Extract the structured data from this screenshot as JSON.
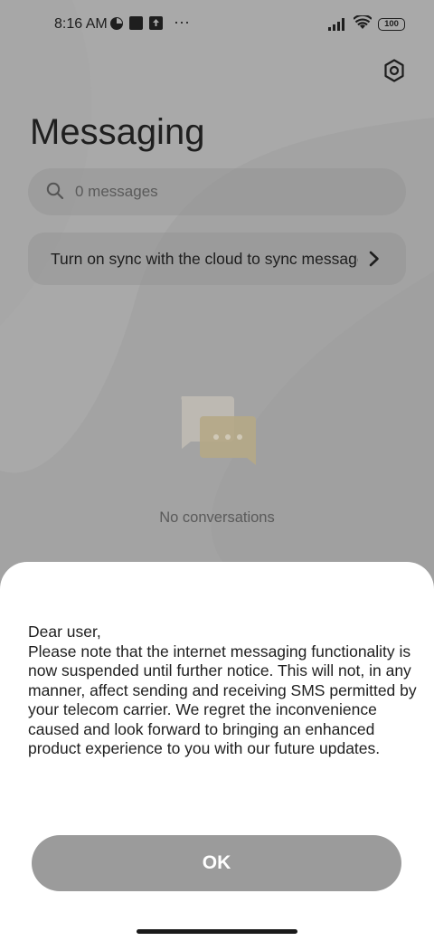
{
  "status_bar": {
    "time": "8:16 AM",
    "battery": "100",
    "icons": [
      "clock-dial-icon",
      "square-notification-icon",
      "upload-notification-icon",
      "more-dots-icon",
      "signal-icon",
      "wifi-icon",
      "battery-icon"
    ],
    "more": "···"
  },
  "header": {
    "title": "Messaging",
    "settings_icon": "settings-gear-icon"
  },
  "search": {
    "placeholder": "0 messages",
    "icon": "search-icon"
  },
  "sync_banner": {
    "text": "Turn on sync with the cloud to sync messages",
    "icon": "chevron-right-icon"
  },
  "empty_state": {
    "icon": "chat-bubbles-icon",
    "text": "No conversations"
  },
  "dialog": {
    "lines": [
      "Dear user,",
      "Please note that the internet messaging functionality is now suspended until further notice. This will not, in any manner, affect sending and receiving SMS permitted by your telecom carrier. We regret the inconvenience caused and look forward to bringing an enhanced product experience to you with our future updates."
    ],
    "ok_label": "OK"
  },
  "colors": {
    "scrim": "#a3a3a3",
    "button": "#9b9b9b",
    "sheet": "#ffffff"
  }
}
